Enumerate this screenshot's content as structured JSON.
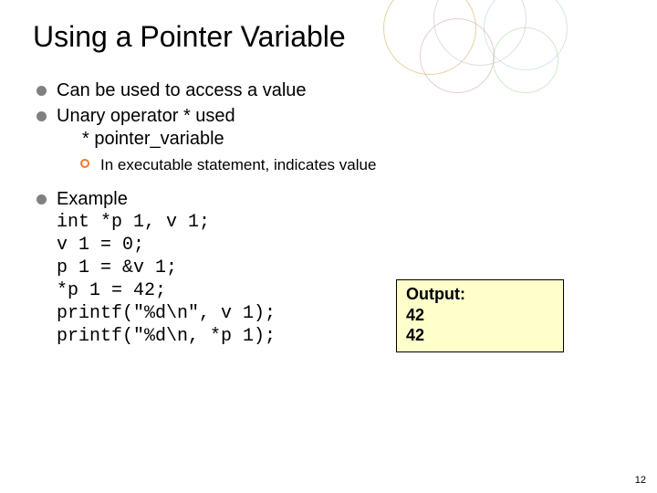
{
  "title": "Using a Pointer Variable",
  "bullets": {
    "b1": "Can be used to access a value",
    "b2_line1": "Unary operator * used",
    "b2_line2": "* pointer_variable",
    "sub1": "In executable statement, indicates value",
    "b3_label": "Example",
    "code": "int *p 1, v 1;\nv 1 = 0;\np 1 = &v 1;\n*p 1 = 42;\nprintf(\"%d\\n\", v 1);\nprintf(\"%d\\n, *p 1);"
  },
  "output": "Output:\n42\n42",
  "page_number": "12"
}
